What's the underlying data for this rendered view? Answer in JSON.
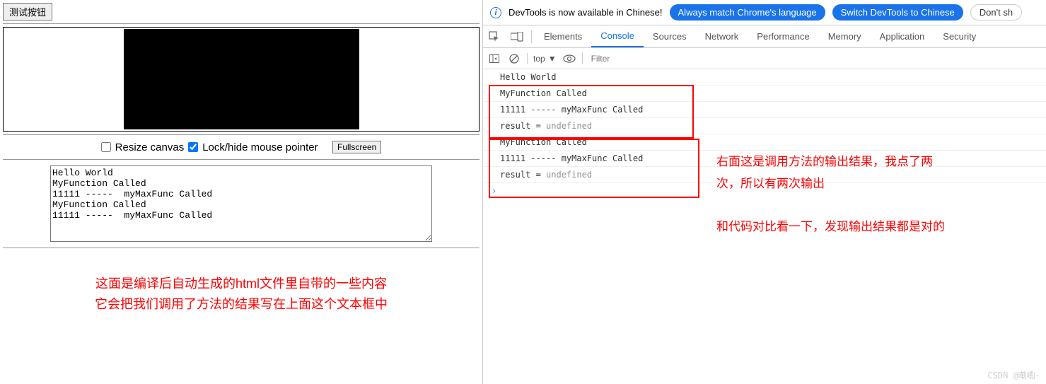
{
  "left": {
    "test_button": "测试按钮",
    "resize_label": "Resize canvas",
    "lock_label": "Lock/hide mouse pointer",
    "fullscreen_label": "Fullscreen",
    "textarea_content": "Hello World\nMyFunction Called\n11111 -----  myMaxFunc Called\nMyFunction Called\n11111 -----  myMaxFunc Called",
    "annotation_line1": "这面是编译后自动生成的html文件里自带的一些内容",
    "annotation_line2": "它会把我们调用了方法的结果写在上面这个文本框中"
  },
  "infobar": {
    "message": "DevTools is now available in Chinese!",
    "pill1": "Always match Chrome's language",
    "pill2": "Switch DevTools to Chinese",
    "pill3": "Don't sh"
  },
  "tabs": {
    "elements": "Elements",
    "console": "Console",
    "sources": "Sources",
    "network": "Network",
    "performance": "Performance",
    "memory": "Memory",
    "application": "Application",
    "security": "Security"
  },
  "toolbar": {
    "context": "top",
    "filter_placeholder": "Filter"
  },
  "console": {
    "lines": [
      {
        "text": "Hello World"
      },
      {
        "text": "MyFunction Called"
      },
      {
        "text": "11111 -----  myMaxFunc Called"
      },
      {
        "prefix": "result = ",
        "value": "undefined"
      },
      {
        "text": "MyFunction Called"
      },
      {
        "text": "11111 -----  myMaxFunc Called"
      },
      {
        "prefix": "result = ",
        "value": "undefined"
      }
    ],
    "prompt": "›"
  },
  "right_annotation": {
    "block1_line1": "右面这是调用方法的输出结果，我点了两",
    "block1_line2": "次，所以有两次输出",
    "block2": "和代码对比看一下，发现输出结果都是对的"
  },
  "watermark": "CSDN @嘞嘞-"
}
